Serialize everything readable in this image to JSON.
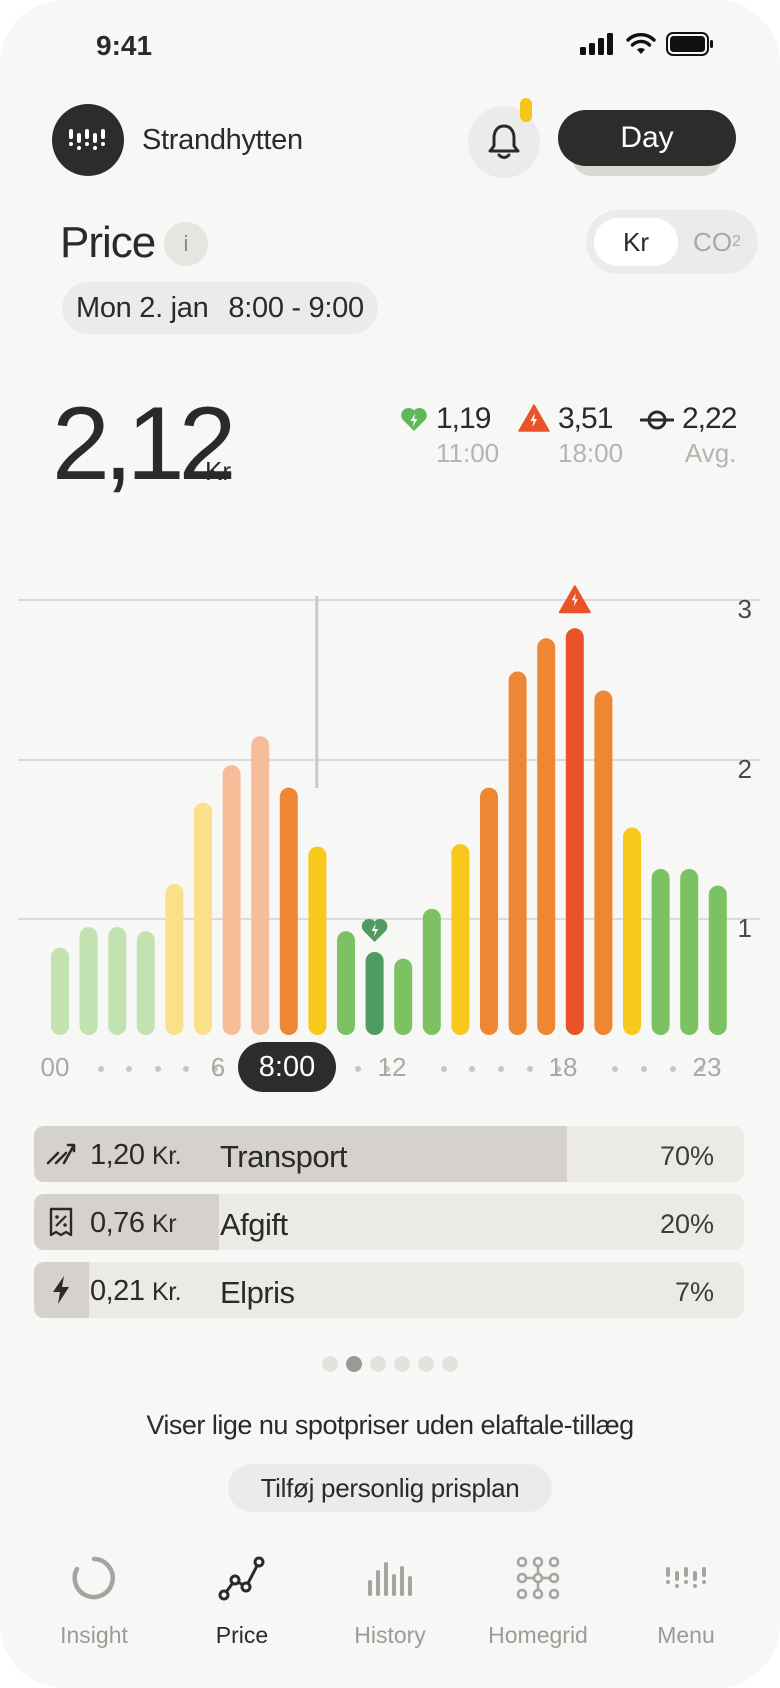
{
  "status_bar": {
    "time": "9:41"
  },
  "header": {
    "site_name": "Strandhytten",
    "period_button": "Day",
    "colors": {
      "dark": "#2d2c2b",
      "notification_dot": "#f5c518"
    }
  },
  "price": {
    "title": "Price",
    "info_label": "i",
    "unit_toggle": {
      "selected": "Kr",
      "kr_label": "Kr",
      "co2_label": "CO",
      "co2_sub": "2"
    },
    "date": "Mon 2. jan",
    "time_range": "8:00 - 9:00",
    "current_value": "2,12",
    "current_unit": "Kr",
    "min": {
      "value": "1,19",
      "time": "11:00",
      "color": "#5fb85a"
    },
    "max": {
      "value": "3,51",
      "time": "18:00",
      "color": "#e8532a"
    },
    "avg": {
      "value": "2,22",
      "label": "Avg."
    }
  },
  "chart_data": {
    "type": "bar",
    "x": [
      0,
      1,
      2,
      3,
      4,
      5,
      6,
      7,
      8,
      9,
      10,
      11,
      12,
      13,
      14,
      15,
      16,
      17,
      18,
      19,
      20,
      21,
      22,
      23
    ],
    "values": [
      1.05,
      1.3,
      1.3,
      1.25,
      1.82,
      2.8,
      3.25,
      3.6,
      2.98,
      2.27,
      1.25,
      1.0,
      0.92,
      1.52,
      2.3,
      2.98,
      4.38,
      4.78,
      4.9,
      4.15,
      2.5,
      2.0,
      2.0,
      1.8
    ],
    "colors": [
      "#c3e2b2",
      "#c3e2b2",
      "#c3e2b2",
      "#c3e2b2",
      "#fbe08a",
      "#fbe08a",
      "#f6bd99",
      "#f6bd99",
      "#ee8733",
      "#f9c81c",
      "#7cc263",
      "#4f9b62",
      "#7cc263",
      "#7cc263",
      "#f9c81c",
      "#ee8733",
      "#ee8733",
      "#ee8733",
      "#e8532a",
      "#ee8733",
      "#f9c81c",
      "#7cc263",
      "#7cc263",
      "#7cc263"
    ],
    "bar_axis_scale": [
      0,
      5
    ],
    "y_tick_labels": [
      "1",
      "2",
      "3"
    ],
    "x_tick_labels": [
      "00",
      "6",
      "12",
      "18",
      "23"
    ],
    "selected_hour_label": "8:00",
    "grid": true
  },
  "breakdown": [
    {
      "icon": "transport-icon",
      "amount": "1,20",
      "unit": "Kr.",
      "name": "Transport",
      "percent": "70%",
      "share": 0.75
    },
    {
      "icon": "tax-receipt-icon",
      "amount": "0,76",
      "unit": "Kr",
      "name": "Afgift",
      "percent": "20%",
      "share": 0.26
    },
    {
      "icon": "lightning-icon",
      "amount": "0,21",
      "unit": "Kr.",
      "name": "Elpris",
      "percent": "7%",
      "share": 0.077
    }
  ],
  "pager": {
    "count": 6,
    "active_index": 1
  },
  "notice": "Viser lige nu spotpriser uden elaftale-tillæg",
  "plan_button": "Tilføj personlig prisplan",
  "nav": [
    {
      "label": "Insight",
      "icon": "loading-ring-icon",
      "active": false
    },
    {
      "label": "Price",
      "icon": "line-graph-icon",
      "active": true
    },
    {
      "label": "History",
      "icon": "bar-history-icon",
      "active": false
    },
    {
      "label": "Homegrid",
      "icon": "grid-nodes-icon",
      "active": false
    },
    {
      "label": "Menu",
      "icon": "menu-waves-icon",
      "active": false
    }
  ]
}
